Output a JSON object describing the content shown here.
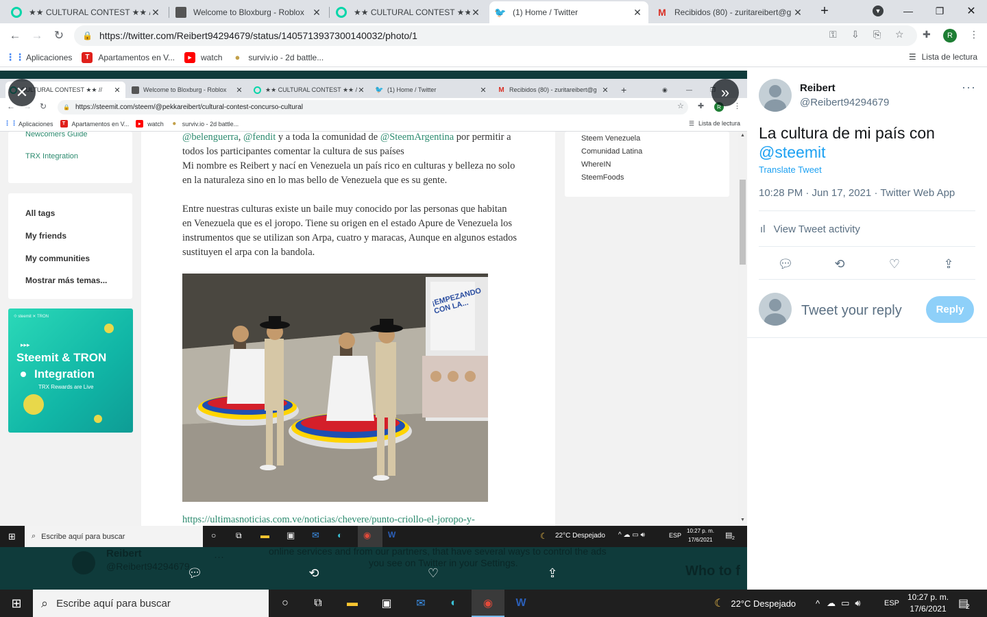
{
  "browser": {
    "tabs": [
      {
        "title": "★★ CULTURAL CONTEST ★★ //",
        "favicon": "steemit-icon",
        "color": "#06d6a9",
        "active": false
      },
      {
        "title": "Welcome to Bloxburg - Roblox",
        "favicon": "roblox-icon",
        "color": "#444444",
        "active": false
      },
      {
        "title": "★★ CULTURAL CONTEST ★★ //",
        "favicon": "steemit-icon",
        "color": "#06d6a9",
        "active": false
      },
      {
        "title": "(1) Home / Twitter",
        "favicon": "twitter-icon",
        "color": "#1da1f2",
        "active": true
      },
      {
        "title": "Recibidos (80) - zuritareibert@g",
        "favicon": "gmail-icon",
        "color": "#d93025",
        "active": false
      }
    ],
    "url": "https://twitter.com/Reibert94294679/status/1405713937300140032/photo/1",
    "profile_initial": "R",
    "bookmarks": [
      {
        "label": "Aplicaciones",
        "icon": "apps-grid-icon"
      },
      {
        "label": "Apartamentos en V...",
        "icon": "trovit-icon",
        "glyph": "T",
        "color": "#e0201b"
      },
      {
        "label": "watch",
        "icon": "youtube-icon",
        "glyph": "▶",
        "color": "#ff0000"
      },
      {
        "label": "surviv.io - 2d battle...",
        "icon": "surviv-icon",
        "glyph": "●",
        "color": "#c2a04a"
      }
    ],
    "reading_list": "Lista de lectura"
  },
  "screenshot": {
    "tabs": [
      {
        "title": "CULTURAL CONTEST ★★ //",
        "color": "#06d6a9",
        "active": true
      },
      {
        "title": "Welcome to Bloxburg - Roblox",
        "color": "#444444",
        "active": false
      },
      {
        "title": "★★ CULTURAL CONTEST ★★ //",
        "color": "#06d6a9",
        "active": false
      },
      {
        "title": "(1) Home / Twitter",
        "color": "#1da1f2",
        "active": false
      },
      {
        "title": "Recibidos (80) - zuritareibert@g",
        "color": "#d93025",
        "active": false
      }
    ],
    "url": "https://steemit.com/steem/@pekkareibert/cultural-contest-concurso-cultural",
    "bookmarks": [
      "Aplicaciones",
      "Apartamentos en V...",
      "watch",
      "surviv.io - 2d battle..."
    ],
    "reading_list": "Lista de lectura",
    "sidebar_links": [
      "Newcomers Guide",
      "TRX Integration"
    ],
    "tags": [
      "All tags",
      "My friends",
      "My communities",
      "Mostrar más temas..."
    ],
    "banner": {
      "top": "⟐ steemit  ✕ TRON",
      "line1": "Steemit & TRON",
      "line2": "Integration",
      "line3": "TRX Rewards are Live"
    },
    "communities": [
      "Steem Venezuela",
      "Comunidad Latina",
      "WhereIN",
      "SteemFoods"
    ],
    "paragraphs": {
      "p1_a": "@belenguerra",
      "p1_b": ", ",
      "p1_c": "@fendit",
      "p1_d": " y a toda la comunidad de ",
      "p1_e": "@SteemArgentina",
      "p1_f": " por permitir a todos los participantes comentar la cultura de sus países",
      "p2": "Mi nombre es Reibert y nací en Venezuela un país rico en culturas y belleza no solo en la naturaleza sino en lo mas bello de Venezuela que es su gente.",
      "p3": "Entre nuestras culturas existe un baile muy conocido por las personas que habitan en Venezuela que es el joropo. Tiene su origen en el estado Apure de Venezuela los instrumentos que se utilizan son Arpa, cuatro y maracas, Aunque en algunos estados sustituyen el arpa con la bandola.",
      "link": "https://ultimasnoticias.com.ve/noticias/chevere/punto-criollo-el-joropo-y-"
    },
    "photo_sign": "¡EMPEZANDO CON LA...",
    "taskbar_search": "Escribe aquí para buscar",
    "weather": "22°C  Despejado",
    "lang": "ESP",
    "time": "10:27 p. m.",
    "date": "17/6/2021",
    "notif_count": "2"
  },
  "overlay_ghost": {
    "name": "Reibert",
    "handle": "@Reibert94294679",
    "text1": "online services and from our partners, that have several ways to control the ads",
    "text2": "you see on Twitter in your Settings.",
    "who": "Who to f"
  },
  "tweet": {
    "name": "Reibert",
    "handle": "@Reibert94294679",
    "text_plain": "La cultura de mi país con",
    "mention": "@steemit",
    "translate": "Translate Tweet",
    "meta": "10:28 PM · Jun 17, 2021 · Twitter Web App",
    "activity": "View Tweet activity",
    "reply_placeholder": "Tweet your reply",
    "reply_button": "Reply"
  },
  "taskbar": {
    "search_placeholder": "Escribe aquí para buscar",
    "weather": "22°C  Despejado",
    "lang": "ESP",
    "time": "10:27 p. m.",
    "date": "17/6/2021",
    "notif_count": "2"
  },
  "colors": {
    "twitter_blue": "#1da1f2",
    "steemit_green": "#2b8a6e",
    "overlay_bg": "#0f3b3b"
  }
}
